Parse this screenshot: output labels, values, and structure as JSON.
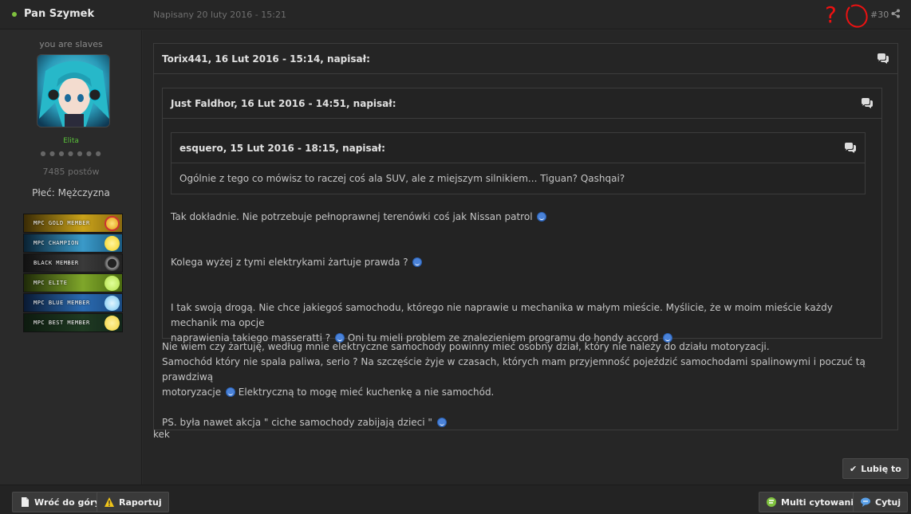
{
  "header": {
    "author": "Pan Szymek",
    "date": "Napisany 20 luty 2016 - 15:21",
    "annotation_mark": "?",
    "post_number": "#30"
  },
  "sidebar": {
    "user_title": "you are slaves",
    "group": "Elita",
    "rank_pips": "● ● ● ● ● ● ●",
    "post_count": "7485 postów",
    "gender": "Płeć: Mężczyzna",
    "badges": [
      {
        "label": "MPC GOLD MEMBER",
        "color": "#c9a21a",
        "icon_color": "#ffcc33"
      },
      {
        "label": "MPC CHAMPION",
        "color": "#3a9ac9",
        "icon_color": "#f5d11a"
      },
      {
        "label": "BLACK MEMBER",
        "color": "#3a3a3a",
        "icon_color": "#888888"
      },
      {
        "label": "MPC ELITE",
        "color": "#7fa62a",
        "icon_color": "#b3e04a"
      },
      {
        "label": "MPC BLUE MEMBER",
        "color": "#2a6ab0",
        "icon_color": "#7ac8f0"
      },
      {
        "label": "MPC BEST MEMBER",
        "color": "#1f3a22",
        "icon_color": "#f3d23a"
      }
    ]
  },
  "quotes": {
    "outer": {
      "citation": "Torix441, 16 Lut 2016 - 15:14, napisał:"
    },
    "middle": {
      "citation": "Just Faldhor, 16 Lut 2016 - 14:51, napisał:"
    },
    "inner": {
      "citation": "esquero, 15 Lut 2016 - 18:15, napisał:",
      "text": "Ogólnie z tego co mówisz to raczej coś ala SUV, ale z miejszym silnikiem... Tiguan? Qashqai?"
    },
    "middle_text": {
      "p1": "Tak dokładnie. Nie potrzebuje pełnoprawnej terenówki coś jak Nissan patrol",
      "p2": "Kolega wyżej z tymi elektrykami żartuje prawda ?",
      "p3a": "I tak swoją drogą. Nie chce jakiegoś samochodu, którego nie naprawie u mechanika w małym mieście. Myślicie, że w moim mieście każdy mechanik ma opcje",
      "p3b": "naprawienia takiego masseratti  ?",
      "p3c": "Oni tu mieli problem ze znalezieniem programu do hondy accord"
    },
    "outer_text": {
      "l1": "Nie wiem czy żartuję, według mnie elektryczne samochody powinny mieć osobny dział, który nie należy do działu motoryzacji.",
      "l2": "Samochód który nie spala paliwa, serio ?  Na szczęście żyje w czasach, których mam przyjemność pojeździć samochodami spalinowymi i poczuć tą prawdziwą",
      "l3a": "motoryzacje",
      "l3b": "Elektryczną to mogę mieć kuchenkę a nie samochód.",
      "l4": "PS. była nawet akcja \" ciche samochody zabijają dzieci \""
    }
  },
  "post_text": "kek",
  "buttons": {
    "like": "Lubię to",
    "back_to_top": "Wróć do góry",
    "report": "Raportuj",
    "multiquote": "Multi cytowanie",
    "quote": "Cytuj"
  },
  "colors": {
    "accent_green": "#7fc23e",
    "annotation_red": "#e11111",
    "group_green": "#5ac23a"
  }
}
